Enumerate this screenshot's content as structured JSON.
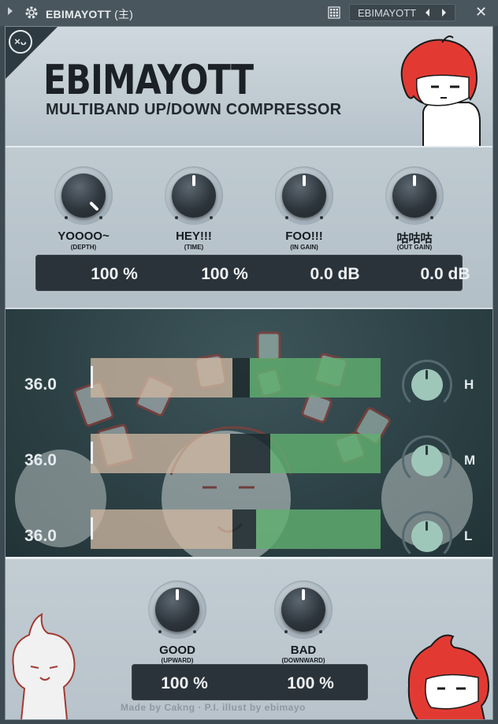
{
  "titlebar": {
    "title": "EBIMAYOTT",
    "title_suffix": "(主)",
    "preset_name": "EBIMAYOTT",
    "close_glyph": "✕"
  },
  "header": {
    "corner_logo_glyph": "×ᴗ",
    "title": "EBIMAYOTT",
    "subtitle": "MULTIBAND UP/DOWN COMPRESSOR"
  },
  "knobs": [
    {
      "label": "YOOOO~",
      "sublabel": "(DEPTH)",
      "value": "100 %",
      "level": 1.0
    },
    {
      "label": "HEY!!!",
      "sublabel": "(TIME)",
      "value": "100 %",
      "level": 0.5
    },
    {
      "label": "FOO!!!",
      "sublabel": "(IN GAIN)",
      "value": "0.0 dB",
      "level": 0.5
    },
    {
      "label": "咕咕咕",
      "sublabel": "(OUT GAIN)",
      "value": "0.0 dB",
      "level": 0.5
    }
  ],
  "bands": [
    {
      "name": "H",
      "value": "36.0",
      "down_fraction": 0.49,
      "up_fraction": 0.45
    },
    {
      "name": "M",
      "value": "36.0",
      "down_fraction": 0.48,
      "up_fraction": 0.38
    },
    {
      "name": "L",
      "value": "36.0",
      "down_fraction": 0.49,
      "up_fraction": 0.43
    }
  ],
  "bottom_knobs": [
    {
      "label": "GOOD",
      "sublabel": "(UPWARD)",
      "value": "100 %",
      "level": 0.5
    },
    {
      "label": "BAD",
      "sublabel": "(DOWNWARD)",
      "value": "100 %",
      "level": 0.5
    }
  ],
  "credit": "Made by Cakng · P.I. illust by ebimayo",
  "colors": {
    "titlebar": "#4a565e",
    "panel": "#b7c3cc",
    "band_bg": "#2d4246",
    "downward_bar": "#cdb6a0",
    "upward_bar": "#60af70",
    "band_knob": "#9ec7ba",
    "value_box": "#2b333a"
  },
  "icons": {
    "titlebar_arrow": "play-triangle-icon",
    "titlebar_gear": "gear-icon",
    "titlebar_grid": "grid-icon",
    "preset_prev": "chevron-left-icon",
    "preset_next": "chevron-right-icon",
    "close": "close-icon"
  }
}
